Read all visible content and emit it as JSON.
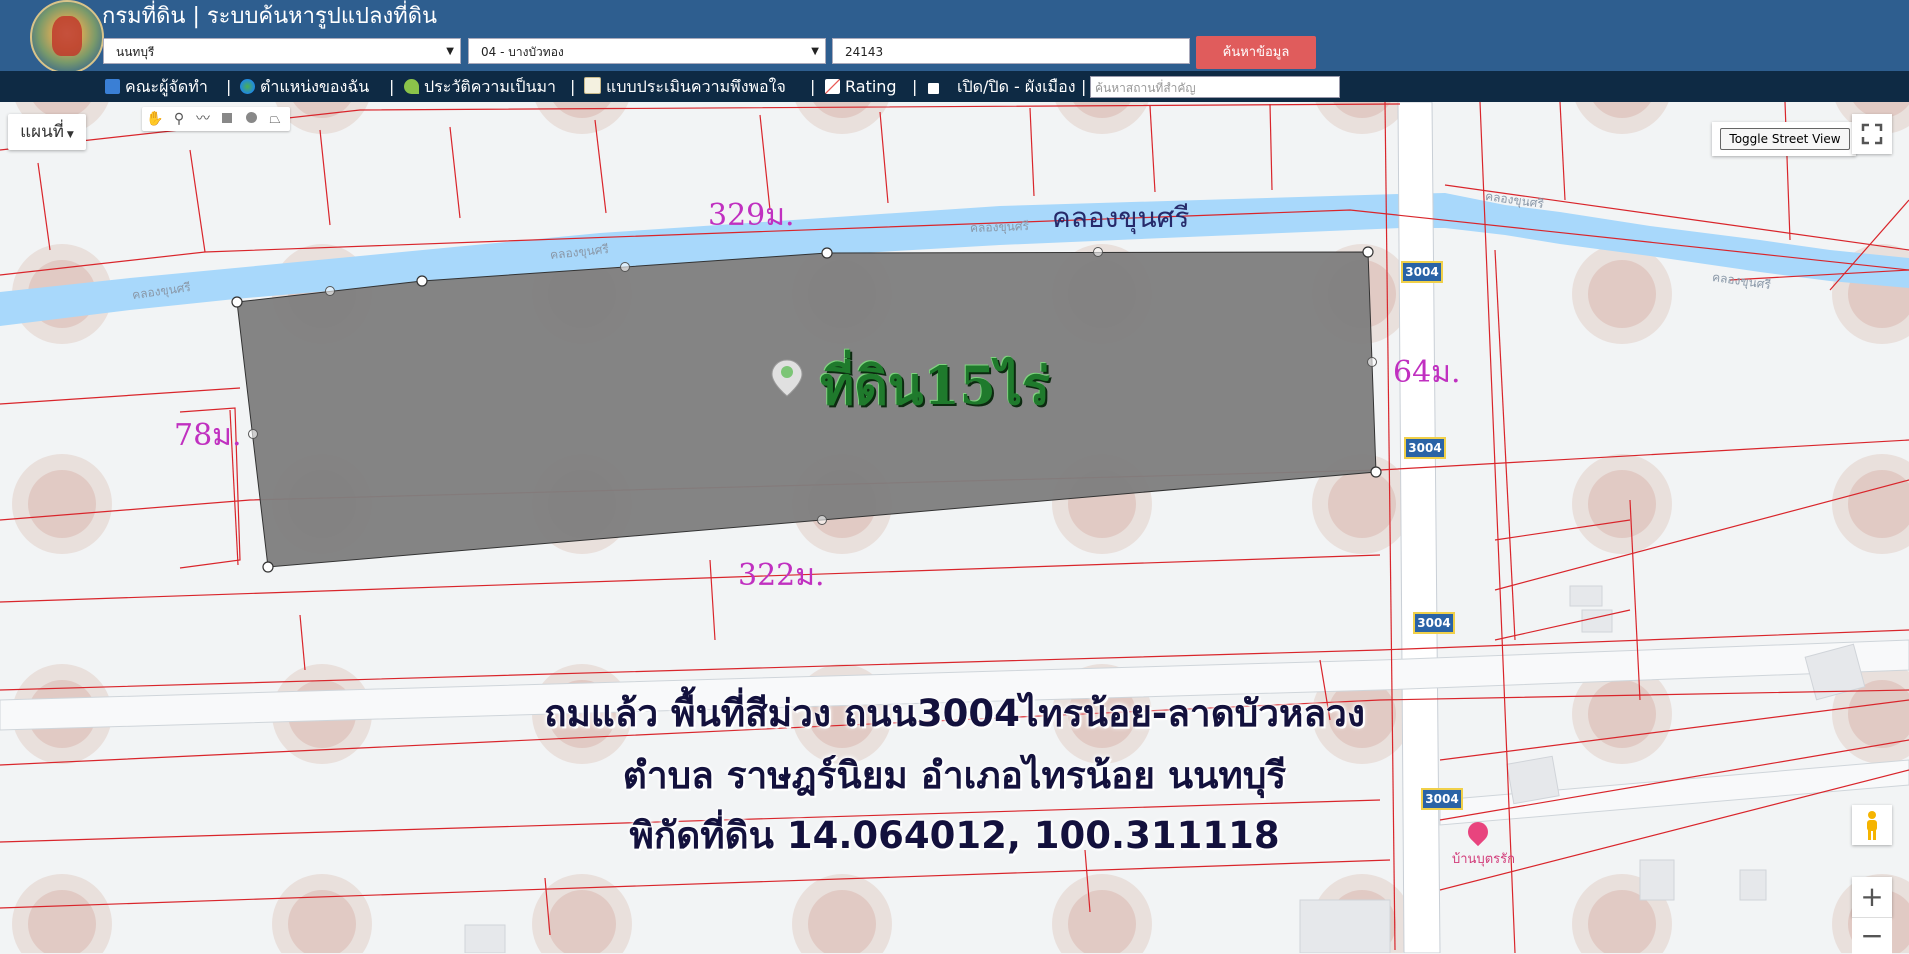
{
  "header": {
    "title": "กรมที่ดิน | ระบบค้นหารูปแปลงที่ดิน",
    "province_select": "นนทบุรี",
    "district_select": "04 - บางบัวทอง",
    "parcel_input": "24143",
    "search_button": "ค้นหาข้อมูล"
  },
  "toolbar": {
    "items": [
      "คณะผู้จัดทำ",
      "ตำแหน่งของฉัน",
      "ประวัติความเป็นมา",
      "แบบประเมินความพึงพอใจ",
      "Rating",
      "เปิด/ปิด - ผังเมือง"
    ],
    "separator": "|",
    "place_search_placeholder": "ค้นหาสถานที่สำคัญ"
  },
  "map": {
    "map_type_button": "แผนที่",
    "toggle_street_view": "Toggle Street View",
    "zoom_in": "+",
    "zoom_out": "−",
    "canal_labels": [
      "คลองขุนศรี",
      "คลองขุนศรี",
      "คลองขุนศรี",
      "คลองขุนศรี",
      "คลองขุนศรี"
    ],
    "canal_label_large": "คลองขุนศรี",
    "road_shields": [
      "3004",
      "3004",
      "3004",
      "3004"
    ],
    "poi_label": "บ้านบุตรรัก",
    "dimensions": {
      "top": "329ม.",
      "right": "64ม.",
      "left": "78ม.",
      "bottom": "322ม."
    },
    "parcel_label": "ที่ดิน15ไร่",
    "overlay_lines": [
      "ถมแล้ว พื้นที่สีม่วง ถนน3004ไทรน้อย-ลาดบัวหลวง",
      "ตำบล ราษฎร์นิยม อำเภอไทรน้อย นนทบุรี",
      "พิกัดที่ดิน 14.064012, 100.311118"
    ]
  },
  "colors": {
    "header_bg": "#2e5e8f",
    "toolbar_bg": "#0e2a44",
    "search_button": "#e05c5c",
    "parcel_fill": "#808080",
    "canal": "#a8d8fb",
    "boundary": "#d9252b",
    "dimension_text": "#c030c0",
    "parcel_label": "#1f7a2c",
    "overlay_text": "#13113d"
  }
}
